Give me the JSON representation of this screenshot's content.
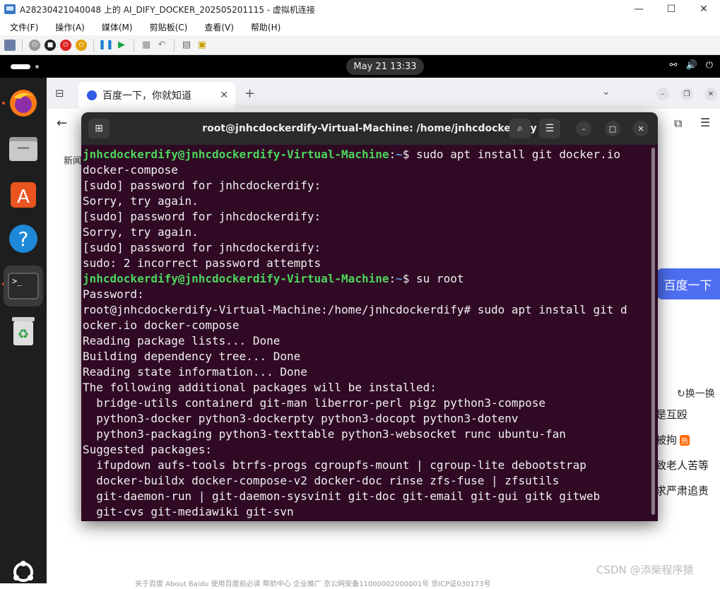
{
  "vm": {
    "title": "A28230421040048 上的 AI_DIFY_DOCKER_202505201115 - 虚拟机连接",
    "menu": [
      "文件(F)",
      "操作(A)",
      "媒体(M)",
      "剪贴板(C)",
      "查看(V)",
      "帮助(H)"
    ],
    "minimize": "—",
    "maximize": "☐",
    "close": "✕"
  },
  "gnome": {
    "clock": "May 21  13:33"
  },
  "browser": {
    "tab_title": "百度一下，你就知道",
    "tab_close": "✕",
    "new_tab": "+",
    "news_link": "新闻",
    "search_button": "百度一下",
    "refresh_link": "换一换",
    "hot_items": [
      {
        "text": "是互殴",
        "badge": ""
      },
      {
        "text": "被拘",
        "badge": "热"
      },
      {
        "text": "致老人苦等",
        "badge": ""
      },
      {
        "text": "求严肃追责",
        "badge": ""
      }
    ],
    "footer": "关于百度   About Baidu   使用百度前必读   帮助中心   企业推广   京公网安备11000002000001号   京ICP证030173号",
    "watermark": "CSDN @添柴程序猿"
  },
  "terminal": {
    "title": "root@jnhcdockerdify-Virtual-Machine: /home/jnhcdockerdify",
    "prompt_user": "jnhcdockerdify@jnhcdockerdify-Virtual-Machine",
    "prompt_path": "~",
    "cmd1": "$ sudo apt install git docker.io",
    "lines_a": [
      "docker-compose",
      "[sudo] password for jnhcdockerdify:",
      "Sorry, try again.",
      "[sudo] password for jnhcdockerdify:",
      "Sorry, try again.",
      "[sudo] password for jnhcdockerdify:",
      "sudo: 2 incorrect password attempts"
    ],
    "cmd2": "$ su root",
    "lines_b": [
      "Password:",
      "root@jnhcdockerdify-Virtual-Machine:/home/jnhcdockerdify# sudo apt install git d",
      "ocker.io docker-compose",
      "Reading package lists... Done",
      "Building dependency tree... Done",
      "Reading state information... Done",
      "The following additional packages will be installed:",
      "  bridge-utils containerd git-man liberror-perl pigz python3-compose",
      "  python3-docker python3-dockerpty python3-docopt python3-dotenv",
      "  python3-packaging python3-texttable python3-websocket runc ubuntu-fan",
      "Suggested packages:",
      "  ifupdown aufs-tools btrfs-progs cgroupfs-mount | cgroup-lite debootstrap",
      "  docker-buildx docker-compose-v2 docker-doc rinse zfs-fuse | zfsutils",
      "  git-daemon-run | git-daemon-sysvinit git-doc git-email git-gui gitk gitweb",
      "  git-cvs git-mediawiki git-svn"
    ]
  }
}
